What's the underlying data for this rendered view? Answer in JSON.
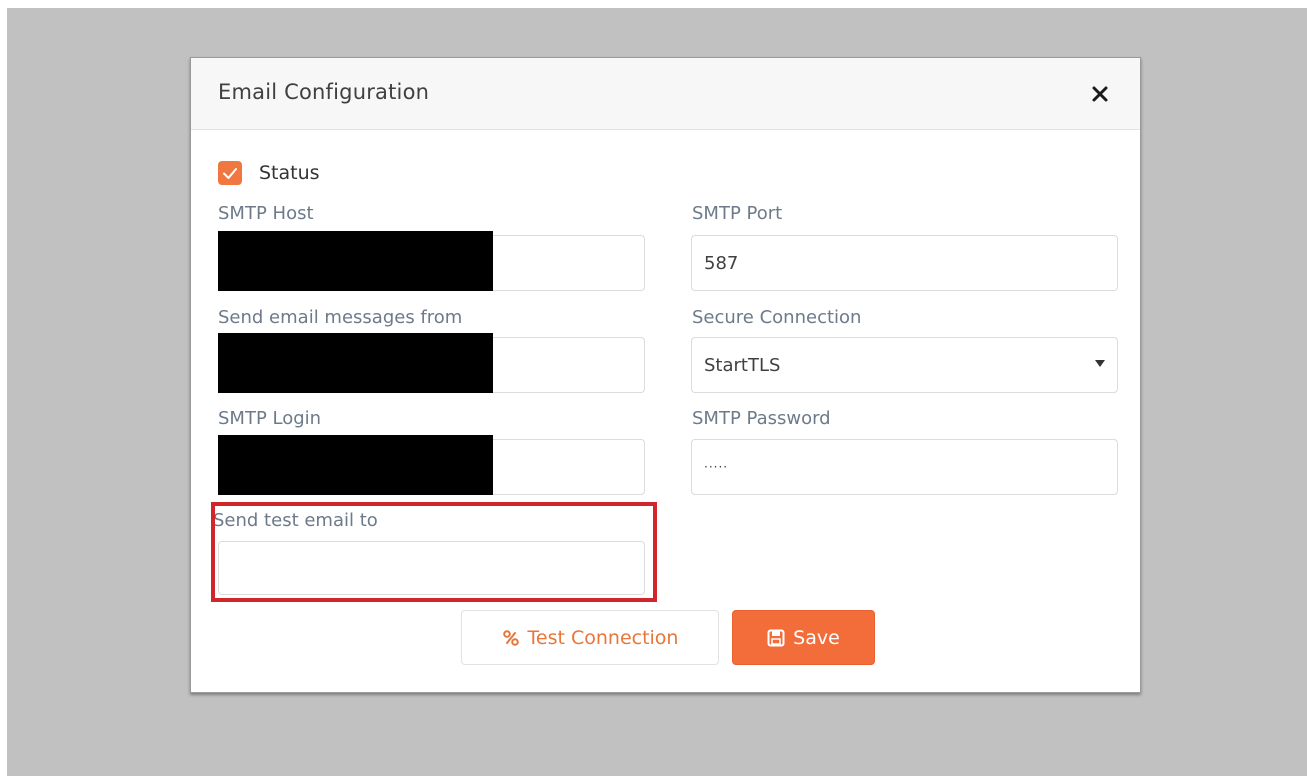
{
  "modal": {
    "title": "Email Configuration",
    "close_glyph": "×"
  },
  "status": {
    "label": "Status",
    "checked": true
  },
  "fields": {
    "smtp_host": {
      "label": "SMTP Host",
      "value": ""
    },
    "smtp_port": {
      "label": "SMTP Port",
      "value": "587"
    },
    "send_from": {
      "label": "Send email messages from",
      "value": ""
    },
    "secure_connection": {
      "label": "Secure Connection",
      "value": "StartTLS"
    },
    "smtp_login": {
      "label": "SMTP Login",
      "value": ""
    },
    "smtp_password": {
      "label": "SMTP Password",
      "value": "·····"
    },
    "test_email": {
      "label": "Send test email to",
      "value": ""
    }
  },
  "buttons": {
    "test_connection": "Test Connection",
    "save": "Save"
  },
  "icons": {
    "close": "close-icon",
    "checkbox": "checkmark-icon",
    "caret": "chevron-down-icon",
    "test": "link-icon",
    "save": "floppy-disk-icon"
  },
  "colors": {
    "accent": "#f26d3a",
    "highlight": "#d1262c",
    "label": "#6c7a8a"
  }
}
